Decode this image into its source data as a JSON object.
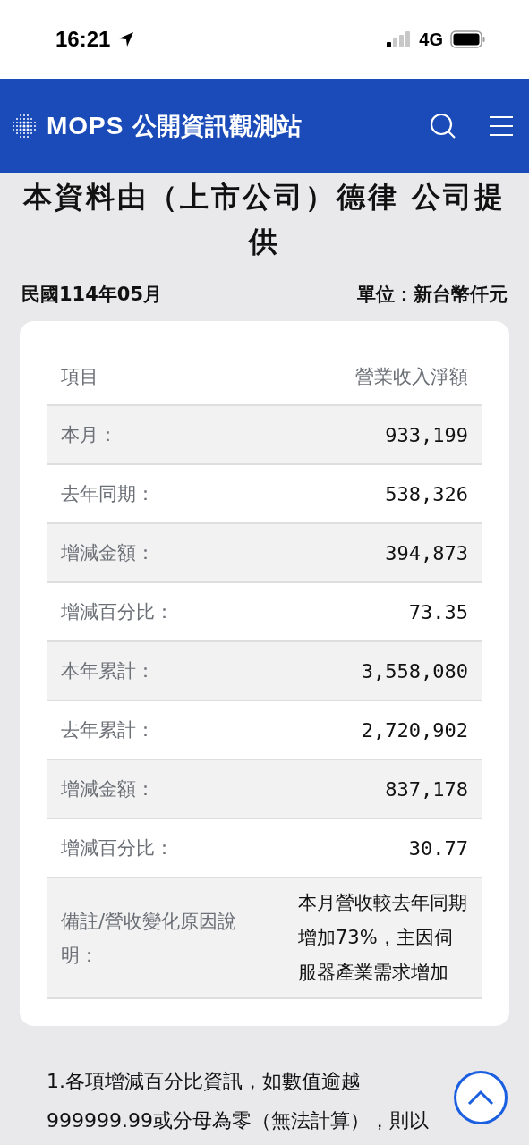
{
  "status_bar": {
    "time": "16:21",
    "network": "4G"
  },
  "nav": {
    "brand": "MOPS",
    "title": "公開資訊觀測站"
  },
  "heading": "本資料由（上市公司）德律 公司提供",
  "period": "民國114年05月",
  "unit": "單位：新台幣仟元",
  "table": {
    "columns": [
      "項目",
      "營業收入淨額"
    ],
    "rows": [
      {
        "label": "本月：",
        "value": "933,199",
        "kind": "number"
      },
      {
        "label": "去年同期：",
        "value": "538,326",
        "kind": "number"
      },
      {
        "label": "增減金額：",
        "value": "394,873",
        "kind": "number"
      },
      {
        "label": "增減百分比：",
        "value": "73.35",
        "kind": "number"
      },
      {
        "label": "本年累計：",
        "value": "3,558,080",
        "kind": "number"
      },
      {
        "label": "去年累計：",
        "value": "2,720,902",
        "kind": "number"
      },
      {
        "label": "增減金額：",
        "value": "837,178",
        "kind": "number"
      },
      {
        "label": "增減百分比：",
        "value": "30.77",
        "kind": "number"
      },
      {
        "label": "備註/營收變化原因說明：",
        "value": "本月營收較去年同期增加73%，主因伺服器產業需求增加",
        "kind": "note"
      }
    ]
  },
  "notes": [
    "1.各項增減百分比資訊，如數值逾越",
    "999999.99或分母為零（無法計算），則以"
  ]
}
